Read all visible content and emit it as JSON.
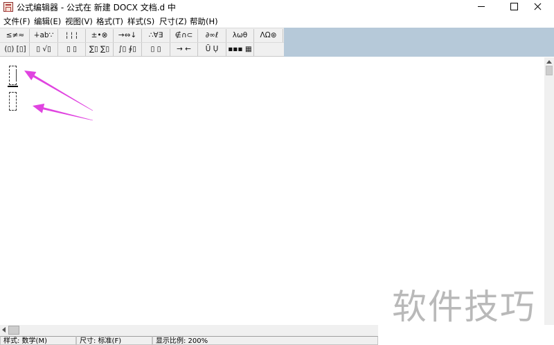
{
  "window": {
    "title": "公式编辑器 - 公式在 新建 DOCX 文档.d 中",
    "app_icon": "equation-editor-icon",
    "controls": {
      "minimize": "minimize-icon",
      "maximize": "maximize-icon",
      "close": "close-icon"
    }
  },
  "menu": {
    "items": [
      "文件(F)",
      "编辑(E)",
      "视图(V)",
      "格式(T)",
      "样式(S)",
      "尺寸(Z)",
      "帮助(H)"
    ]
  },
  "toolbar": {
    "row1": [
      "≤≠≈",
      "∔ab∵",
      "¦ ¦ ¦",
      "±•⊗",
      "→⇔↓",
      "∴∀∃",
      "∉∩⊂",
      "∂∞ℓ",
      "λωθ",
      "ΛΩ⊛"
    ],
    "row2": [
      "(▯) [▯]",
      "▯ √▯",
      "▯ ▯",
      "∑▯ ∑▯",
      "∫▯ ∮▯",
      "▯ ▯",
      "→ ←",
      "Ũ Ụ",
      "▪▪▪ ▦"
    ],
    "accent_bg": "#b6c9d9"
  },
  "editor": {
    "template": "fraction",
    "slots": [
      "numerator",
      "denominator"
    ],
    "annotation_color": "#e044e0"
  },
  "statusbar": {
    "style": "样式: 数学(M)",
    "size": "尺寸: 标准(F)",
    "zoom": "显示比例: 200%"
  },
  "watermark": "软件技巧"
}
